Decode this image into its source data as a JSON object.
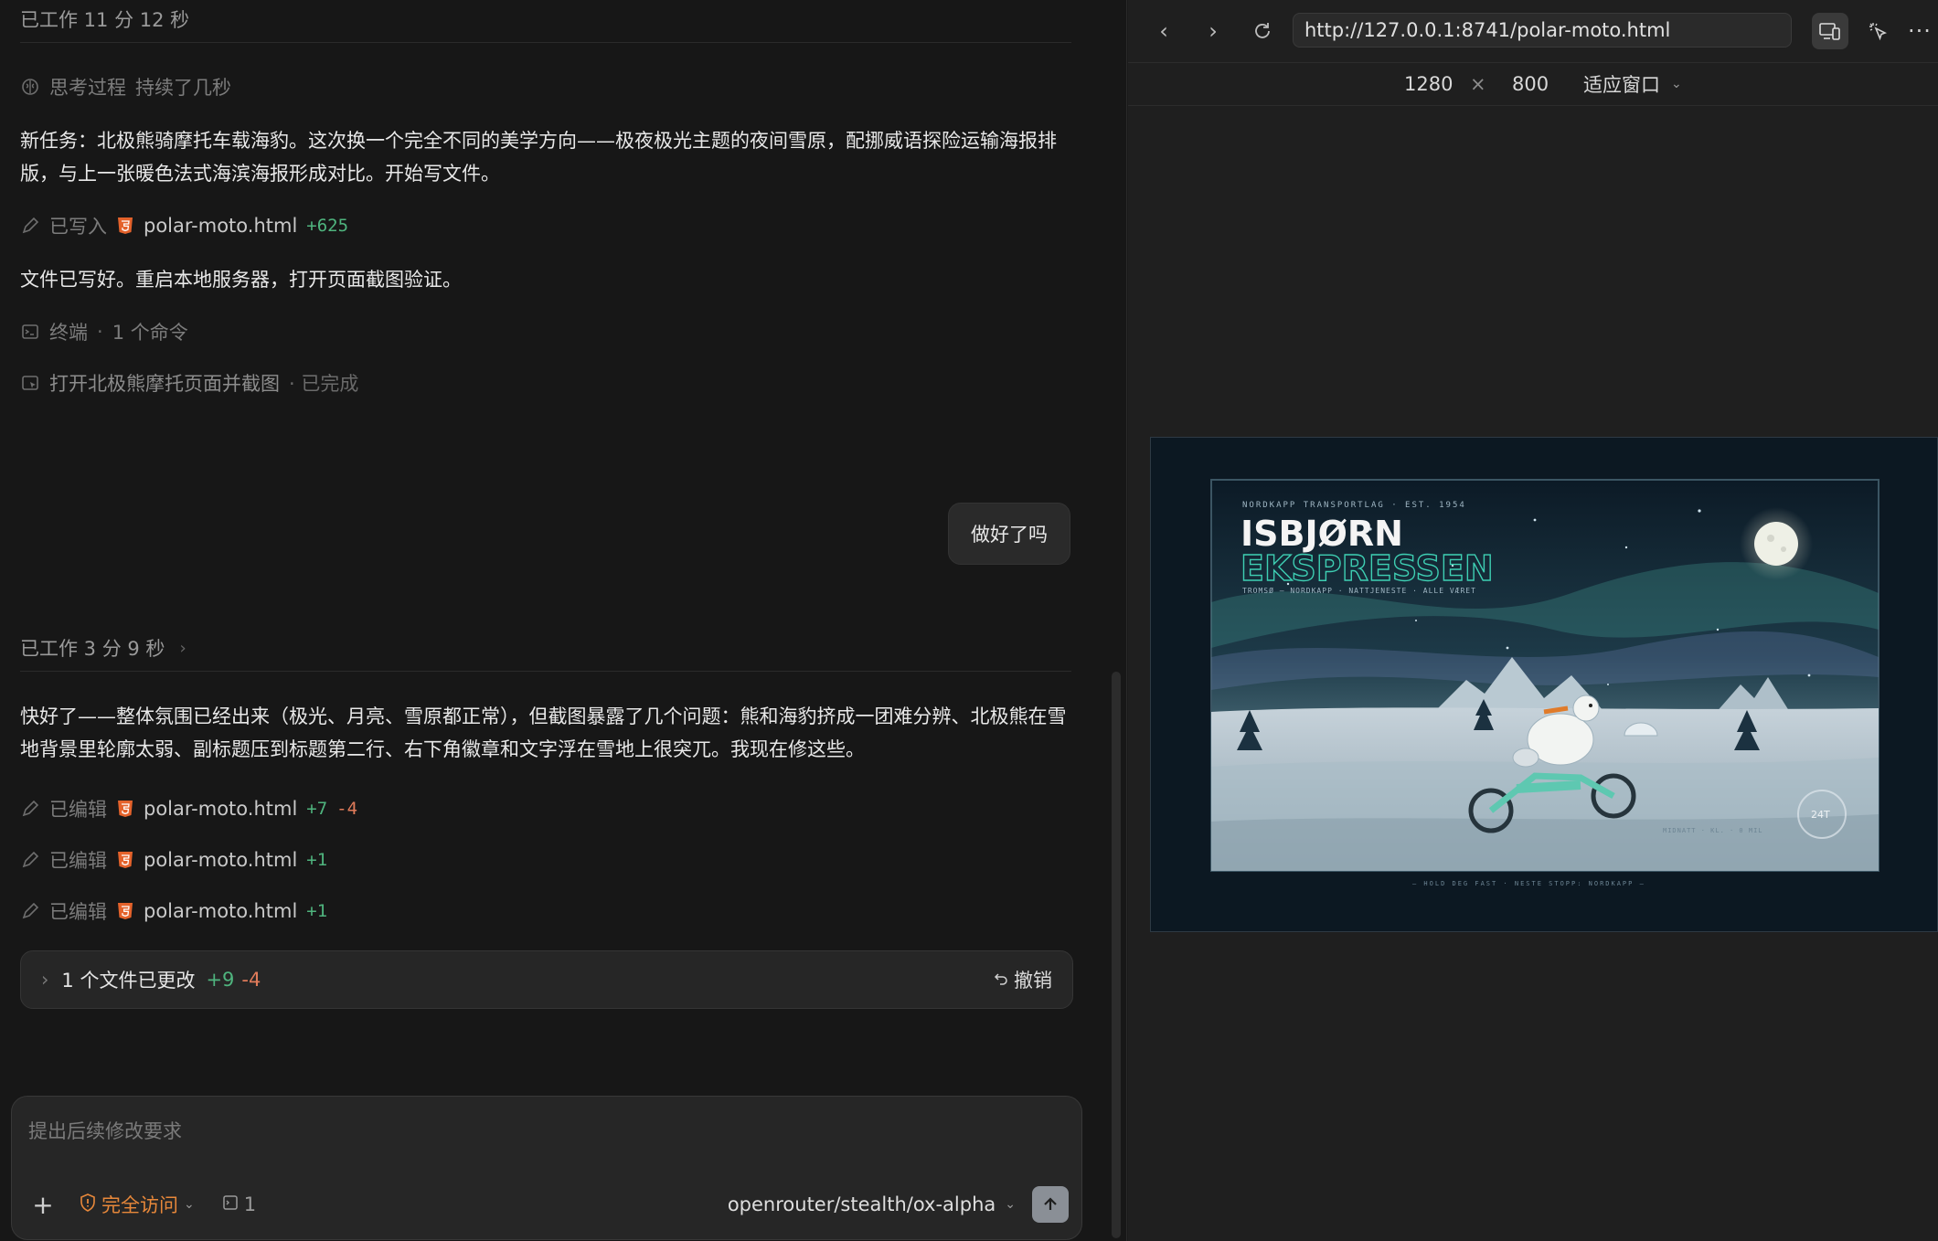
{
  "chat": {
    "worked_top": "已工作 11 分 12 秒",
    "thinking_label": "思考过程",
    "thinking_duration": "持续了几秒",
    "msg1": "新任务：北极熊骑摩托车载海豹。这次换一个完全不同的美学方向——极夜极光主题的夜间雪原，配挪威语探险运输海报排版，与上一张暖色法式海滨海报形成对比。开始写文件。",
    "write_action": {
      "label": "已写入",
      "file": "polar-moto.html",
      "plus": "+625"
    },
    "msg2": "文件已写好。重启本地服务器，打开页面截图验证。",
    "terminal": {
      "label": "终端",
      "sep": "·",
      "count": "1 个命令"
    },
    "browse": {
      "label": "打开北极熊摩托页面并截图",
      "status": "· 已完成"
    },
    "user_bubble": "做好了吗",
    "worked_2": "已工作 3 分 9 秒",
    "msg3": "快好了——整体氛围已经出来（极光、月亮、雪原都正常），但截图暴露了几个问题：熊和海豹挤成一团难分辨、北极熊在雪地背景里轮廓太弱、副标题压到标题第二行、右下角徽章和文字浮在雪地上很突兀。我现在修这些。",
    "edits": [
      {
        "label": "已编辑",
        "file": "polar-moto.html",
        "plus": "+7",
        "minus": "-4"
      },
      {
        "label": "已编辑",
        "file": "polar-moto.html",
        "plus": "+1",
        "minus": ""
      },
      {
        "label": "已编辑",
        "file": "polar-moto.html",
        "plus": "+1",
        "minus": ""
      }
    ],
    "changed": {
      "label": "1 个文件已更改",
      "plus": "+9",
      "minus": "-4",
      "undo": "撤销"
    }
  },
  "composer": {
    "placeholder": "提出后续修改要求",
    "access": "完全访问",
    "context_count": "1",
    "model": "openrouter/stealth/ox-alpha"
  },
  "browser": {
    "url": "http://127.0.0.1:8741/polar-moto.html",
    "width": "1280",
    "times": "×",
    "height": "800",
    "fit": "适应窗口"
  },
  "poster": {
    "kicker": "NORDKAPP TRANSPORTLAG · EST. 1954",
    "title1": "ISBJØRN",
    "title2": "EKSPRESSEN",
    "subtitle": "TROMSØ — NORDKAPP · NATTJENESTE · ALLE VÆRET",
    "badge": "24T",
    "corner_text": "MIDNATT · KL. · 0 MIL",
    "footer": "— HOLD DEG FAST · NESTE STOPP: NORDKAPP —"
  },
  "colors": {
    "accent_orange": "#e8883a",
    "plus_green": "#4fb47e",
    "minus_orange": "#e07b5a",
    "poster_teal": "#3ecfb3"
  }
}
